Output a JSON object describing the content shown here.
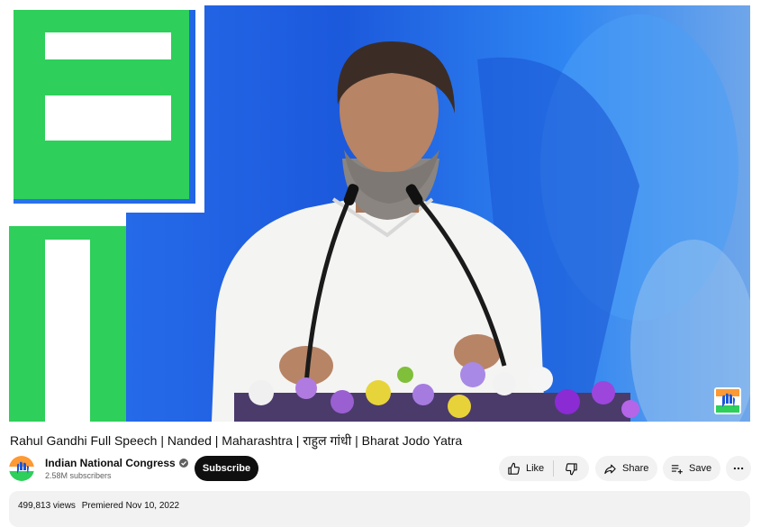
{
  "video": {
    "title": "Rahul Gandhi Full Speech | Nanded | Maharashtra | राहुल गांधी | Bharat Jodo Yatra"
  },
  "channel": {
    "name": "Indian National Congress",
    "subscribers": "2.58M subscribers",
    "subscribe_label": "Subscribe",
    "verified_icon": "verified-check-icon"
  },
  "actions": {
    "like_label": "Like",
    "share_label": "Share",
    "save_label": "Save"
  },
  "description": {
    "views": "499,813 views",
    "premiered": "Premiered Nov 10, 2022"
  },
  "colors": {
    "subscribe_bg": "#0f0f0f",
    "pill_bg": "#f2f2f2",
    "stage_blue": "#1f63e6",
    "stage_green": "#2ecf5a"
  }
}
